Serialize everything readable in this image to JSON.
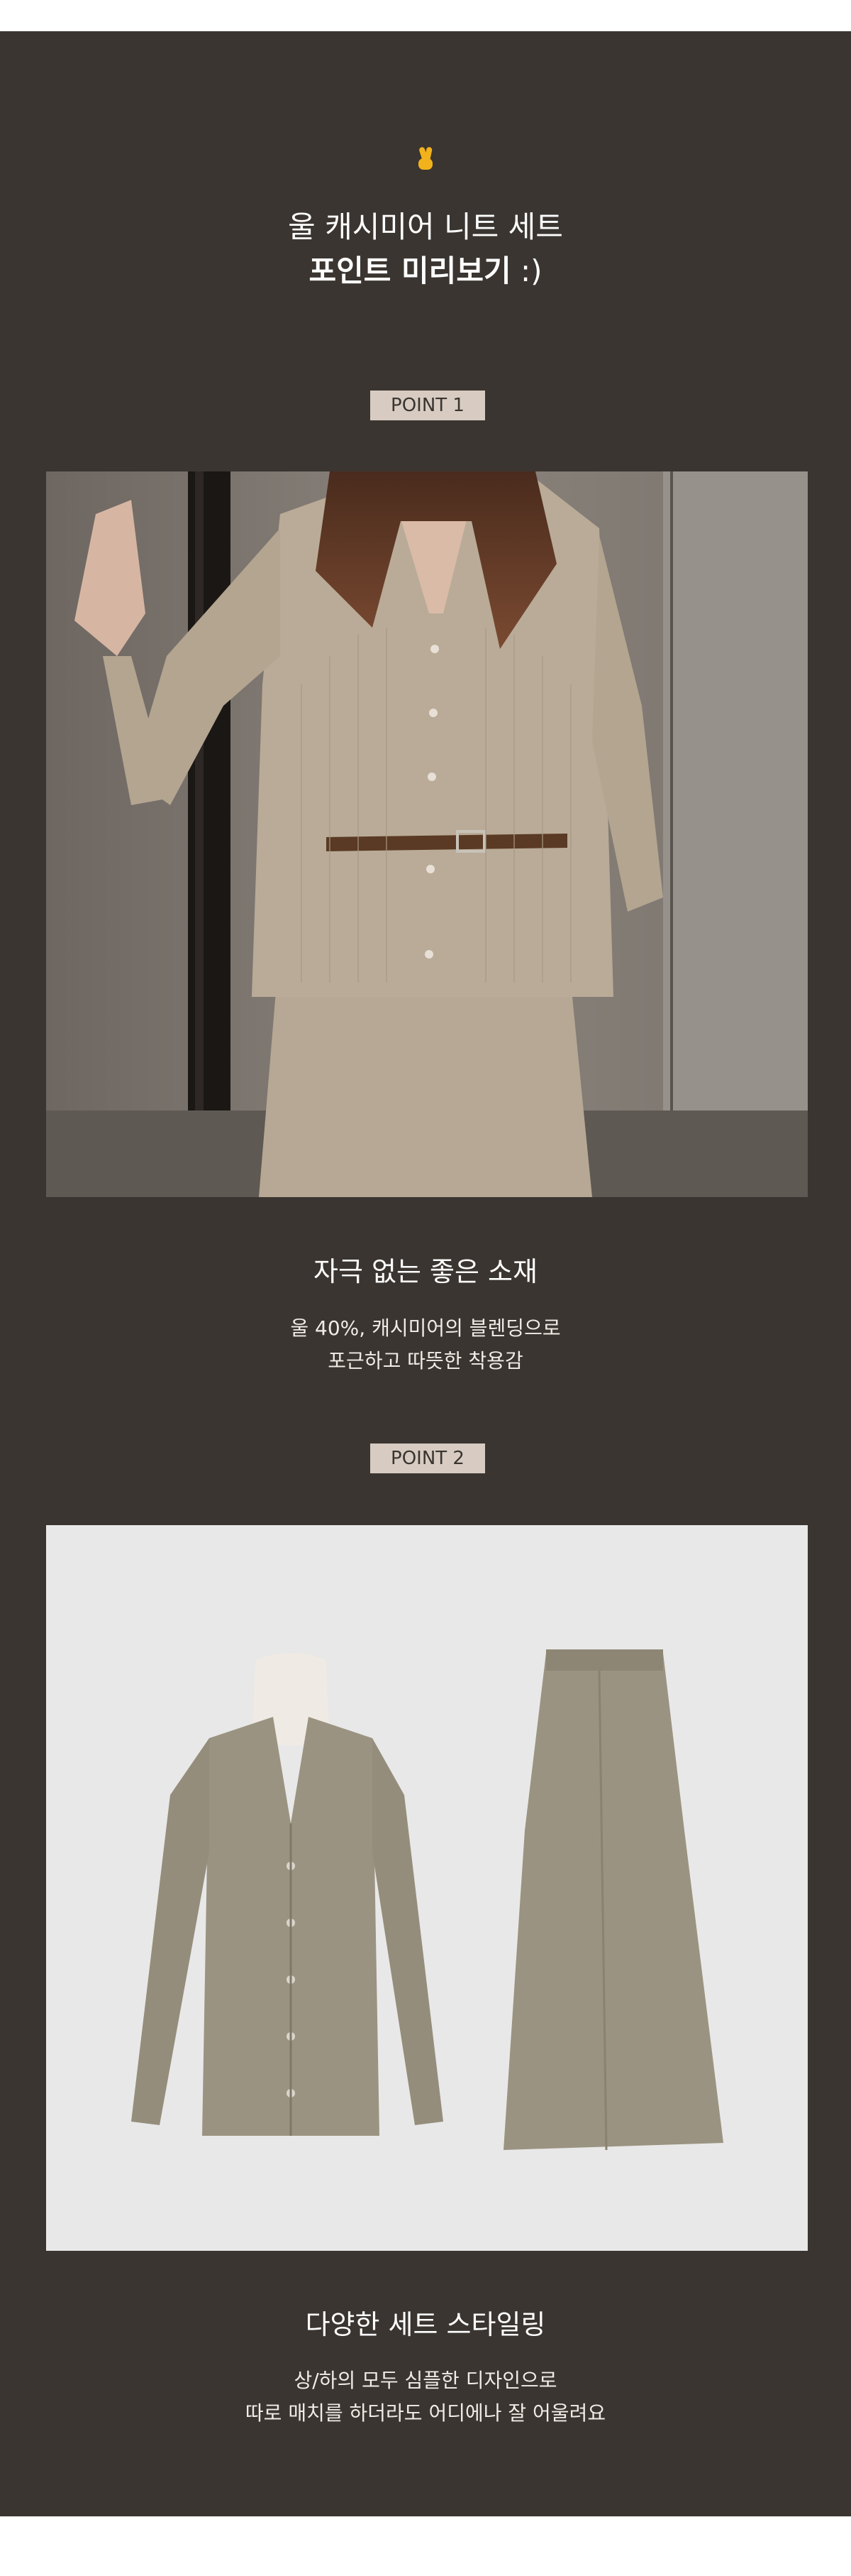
{
  "header": {
    "emoji": "✌",
    "title_line1": "울 캐시미어 니트 세트",
    "title_line2_bold": "포인트 미리보기",
    "title_line2_suffix": " :)"
  },
  "points": [
    {
      "badge": "POINT 1",
      "image_alt": "model wearing beige ribbed V-neck cardigan with brown belt and matching knit skirt",
      "heading": "자극 없는 좋은 소재",
      "desc_line1": "울 40%, 캐시미어의 블렌딩으로",
      "desc_line2": "포근하고 따뜻한 착용감"
    },
    {
      "badge": "POINT 2",
      "image_alt": "flat product shot of gray-beige knit cardigan and long knit skirt",
      "heading": "다양한 세트 스타일링",
      "desc_line1": "상/하의 모두 심플한 디자인으로",
      "desc_line2": "따로 매치를 하더라도 어디에나 잘 어울려요"
    }
  ],
  "colors": {
    "background": "#3a3530",
    "badge_bg": "#d8ccc2",
    "knit": "#b9ab97",
    "knit_product": "#9b9381"
  }
}
